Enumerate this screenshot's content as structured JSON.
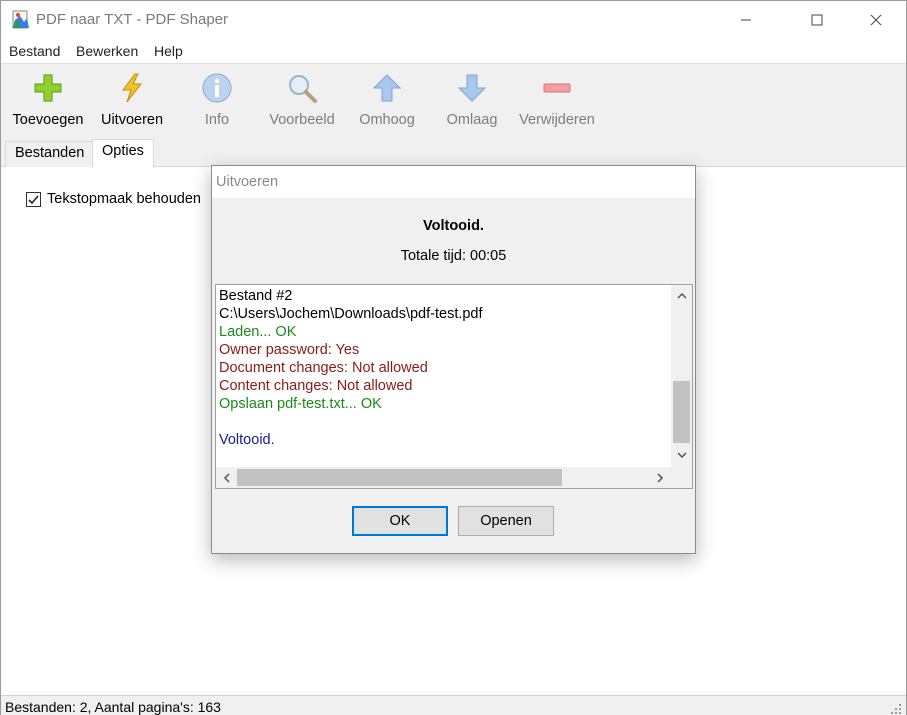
{
  "window": {
    "title": "PDF naar TXT - PDF Shaper"
  },
  "menu": {
    "items": [
      "Bestand",
      "Bewerken",
      "Help"
    ]
  },
  "toolbar": {
    "items": [
      {
        "label": "Toevoegen",
        "icon": "plus-icon",
        "enabled": true
      },
      {
        "label": "Uitvoeren",
        "icon": "lightning-icon",
        "enabled": true
      },
      {
        "label": "Info",
        "icon": "info-icon",
        "enabled": false
      },
      {
        "label": "Voorbeeld",
        "icon": "magnifier-icon",
        "enabled": false
      },
      {
        "label": "Omhoog",
        "icon": "arrow-up-icon",
        "enabled": false
      },
      {
        "label": "Omlaag",
        "icon": "arrow-down-icon",
        "enabled": false
      },
      {
        "label": "Verwijderen",
        "icon": "minus-icon",
        "enabled": false
      }
    ]
  },
  "tabs": {
    "items": [
      "Bestanden",
      "Opties"
    ],
    "active": "Opties"
  },
  "options": {
    "keep_formatting_label": "Tekstopmaak behouden",
    "keep_formatting_checked": true
  },
  "status": {
    "text": "Bestanden: 2, Aantal pagina's: 163"
  },
  "dialog": {
    "title": "Uitvoeren",
    "done": "Voltooid.",
    "total_time": "Totale tijd: 00:05",
    "log": [
      {
        "text": "Bestand #2",
        "color": "#000000"
      },
      {
        "text": "C:\\Users\\Jochem\\Downloads\\pdf-test.pdf",
        "color": "#000000"
      },
      {
        "text": "Laden... OK",
        "color": "#1a8a1a"
      },
      {
        "text": "Owner password: Yes",
        "color": "#8b1a1a"
      },
      {
        "text": "Document changes: Not allowed",
        "color": "#8b1a1a"
      },
      {
        "text": "Content changes: Not allowed",
        "color": "#8b1a1a"
      },
      {
        "text": "Opslaan pdf-test.txt... OK",
        "color": "#1a8a1a"
      },
      {
        "text": "",
        "color": "#000000"
      },
      {
        "text": "Voltooid.",
        "color": "#1a1a9a"
      }
    ],
    "ok_label": "OK",
    "open_label": "Openen"
  }
}
